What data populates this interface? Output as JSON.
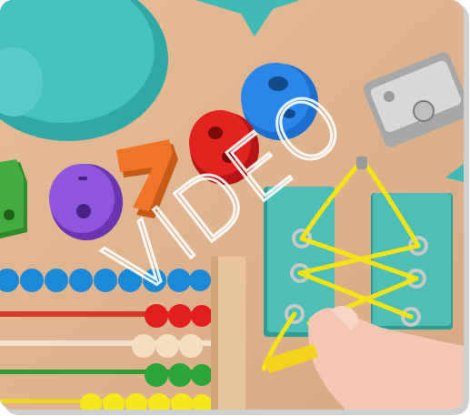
{
  "watermark": {
    "text": "VIDEO"
  },
  "numbers": [
    "5",
    "6",
    "7",
    "8",
    "9"
  ],
  "colors": {
    "board": "#e2b792",
    "teal": "#3fbab6",
    "blue": "#1e7de0",
    "red": "#e11d1d",
    "orange": "#f07024",
    "purple": "#8b4fd8",
    "green": "#3fa33b",
    "yellow": "#f3e81b",
    "cream": "#f4dcc0"
  }
}
